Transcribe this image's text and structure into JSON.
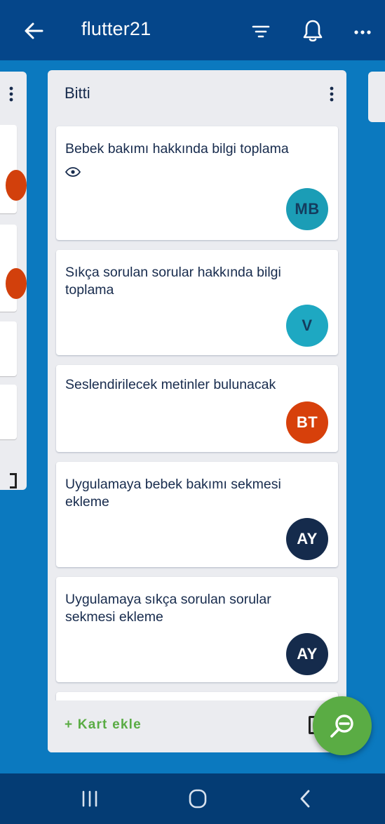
{
  "appbar": {
    "title": "flutter21",
    "icons": [
      "back-arrow-icon",
      "filter-icon",
      "bell-icon",
      "more-icon"
    ]
  },
  "list": {
    "name": "Bitti",
    "cards": [
      {
        "title": "Bebek bakımı hakkında bilgi toplama",
        "watching": true,
        "member_initials": "MB",
        "member_color": "#1b9db6"
      },
      {
        "title": "Sıkça sorulan sorular hakkında bilgi toplama",
        "watching": false,
        "member_initials": "V",
        "member_color": "#1ea8c2"
      },
      {
        "title": "Seslendirilecek metinler bulunacak",
        "watching": false,
        "member_initials": "BT",
        "member_color": "#d7400b"
      },
      {
        "title": "Uygulamaya bebek bakımı sekmesi ekleme",
        "watching": false,
        "member_initials": "AY",
        "member_color": "#152b4c"
      },
      {
        "title": "Uygulamaya sıkça sorulan sorular sekmesi ekleme",
        "watching": false,
        "member_initials": "AY",
        "member_color": "#152b4c"
      }
    ],
    "add_card_label": "+ Kart ekle"
  },
  "colors": {
    "appbar": "#05468a",
    "board": "#0b79bf",
    "list_bg": "#ebecf0",
    "accent_green": "#5aac44",
    "navbar": "#043c74"
  },
  "system_nav": [
    "recent-apps-icon",
    "home-icon",
    "back-icon"
  ]
}
